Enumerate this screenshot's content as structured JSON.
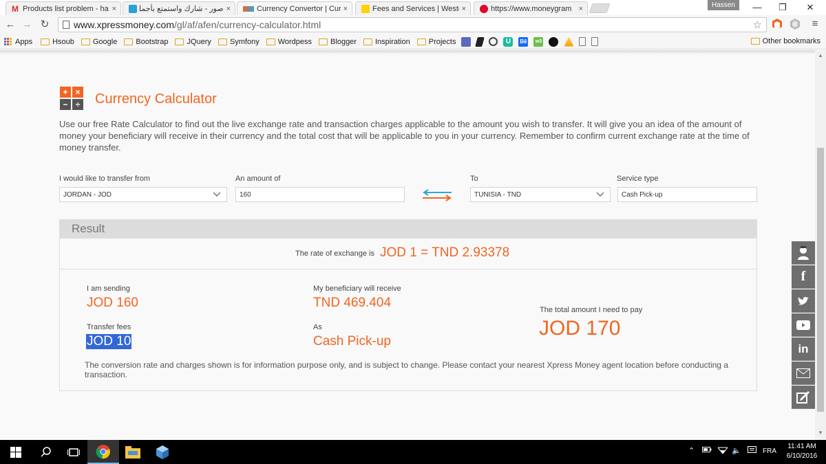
{
  "browser": {
    "tabs": [
      {
        "title": "Products list problem - ha",
        "close": "×"
      },
      {
        "title": "صور - شارك واستمتع بأجمل",
        "close": "×"
      },
      {
        "title": "Currency Convertor | Curr",
        "close": "×"
      },
      {
        "title": "Fees and Services | Weste",
        "close": "×"
      },
      {
        "title": "https://www.moneygram",
        "close": "×"
      }
    ],
    "profile_name": "Hassen",
    "address": {
      "host": "www.xpressmoney.com",
      "path": "/gl/af/afen/currency-calculator.html"
    },
    "bookmarks": [
      "Apps",
      "Hsoub",
      "Google",
      "Bootstrap",
      "JQuery",
      "Symfony",
      "Wordpess",
      "Blogger",
      "Inspiration",
      "Projects"
    ],
    "other_bookmarks": "Other bookmarks"
  },
  "page": {
    "title": "Currency Calculator",
    "calc_symbols": [
      "+",
      "×",
      "−",
      "÷"
    ],
    "intro": "Use our free Rate Calculator to find out the live exchange rate and transaction charges applicable to the amount you wish to transfer. It will give you an idea of the amount of money your beneficiary will receive in their currency and the total cost that will be applicable to you in your currency. Remember to confirm current exchange rate at the time of money transfer.",
    "form": {
      "from_label": "I would like to transfer from",
      "from_value": "JORDAN - JOD",
      "amount_label": "An amount of",
      "amount_value": "160",
      "to_label": "To",
      "to_value": "TUNISIA - TND",
      "service_label": "Service type",
      "service_value": "Cash Pick-up"
    },
    "result": {
      "heading": "Result",
      "rate_label": "The rate of exchange is",
      "rate_value": "JOD 1 = TND 2.93378",
      "sending_label": "I am sending",
      "sending_value": "JOD 160",
      "receive_label": "My beneficiary will receive",
      "receive_value": "TND 469.404",
      "fees_label": "Transfer fees",
      "fees_value": "JOD 10",
      "as_label": "As",
      "as_value": "Cash Pick-up",
      "total_label": "The total amount I need to pay",
      "total_value": "JOD 170",
      "disclaimer": "The conversion rate and charges shown is for information purpose only, and is subject to change. Please contact your nearest Xpress Money agent location before conducting a transaction."
    },
    "social": [
      "agent-locator",
      "facebook",
      "twitter",
      "youtube",
      "linkedin",
      "email",
      "feedback"
    ]
  },
  "taskbar": {
    "language": "FRA",
    "time": "11:41 AM",
    "date": "6/10/2016"
  },
  "colors": {
    "accent": "#f26522",
    "highlight": "#3367d6",
    "swap_orange": "#f26522",
    "swap_blue": "#29a8e0"
  }
}
